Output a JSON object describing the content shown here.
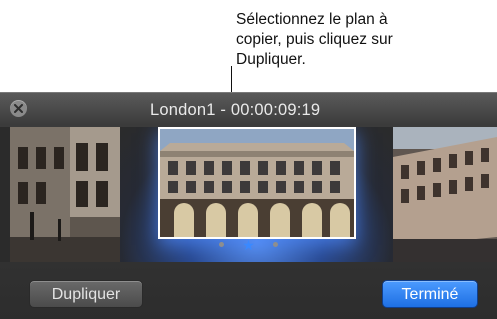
{
  "callout": {
    "lines": [
      "Sélectionnez le plan à",
      "copier, puis cliquez sur",
      "Dupliquer."
    ]
  },
  "window": {
    "title": "London1 - 00:00:09:19",
    "close_icon": "close-icon"
  },
  "filmstrip": {
    "clips": [
      {
        "name": "street-left"
      },
      {
        "name": "london-building-selected"
      },
      {
        "name": "street-right"
      }
    ],
    "selected_index": 1
  },
  "pagination": {
    "count": 3,
    "current": 1,
    "current_icon": "star-icon"
  },
  "buttons": {
    "duplicate_label": "Dupliquer",
    "done_label": "Terminé"
  },
  "colors": {
    "accent": "#2f7ff2",
    "panel": "#333333"
  }
}
